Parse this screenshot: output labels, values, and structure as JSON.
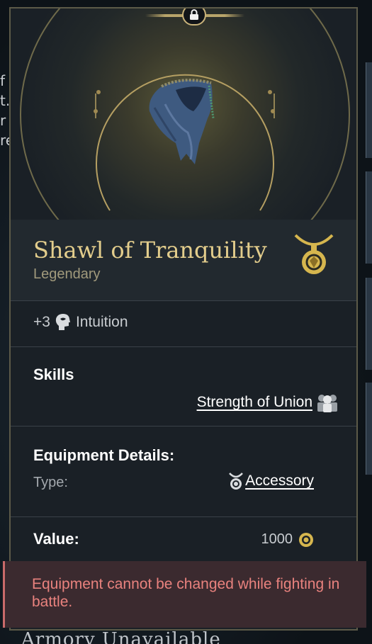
{
  "background": {
    "left_text_fragments": [
      "f",
      "t.",
      "r",
      "re"
    ],
    "bottom_title": "Armory Unavailable"
  },
  "item": {
    "name": "Shawl of Tranquility",
    "rarity": "Legendary",
    "image_icon": "blue-shawl-icon",
    "slot_icon": "amulet-icon",
    "locked": true
  },
  "stats": {
    "bonus": "+3",
    "attribute_icon": "intuition-head-icon",
    "attribute": "Intuition"
  },
  "skills": {
    "heading": "Skills",
    "skill_name": "Strength of Union",
    "skill_icon": "party-icon"
  },
  "equipment_details": {
    "heading": "Equipment Details:",
    "type_label": "Type:",
    "type_value": "Accessory",
    "type_icon": "amulet-icon"
  },
  "value": {
    "label": "Value:",
    "amount": "1000",
    "currency_icon": "gold-coin-icon"
  },
  "warning": {
    "message": "Equipment cannot be changed while fighting in battle."
  },
  "colors": {
    "gold_accent": "#e3cd8c",
    "warning_text": "#e9827e",
    "card_bg": "#1a2026"
  }
}
